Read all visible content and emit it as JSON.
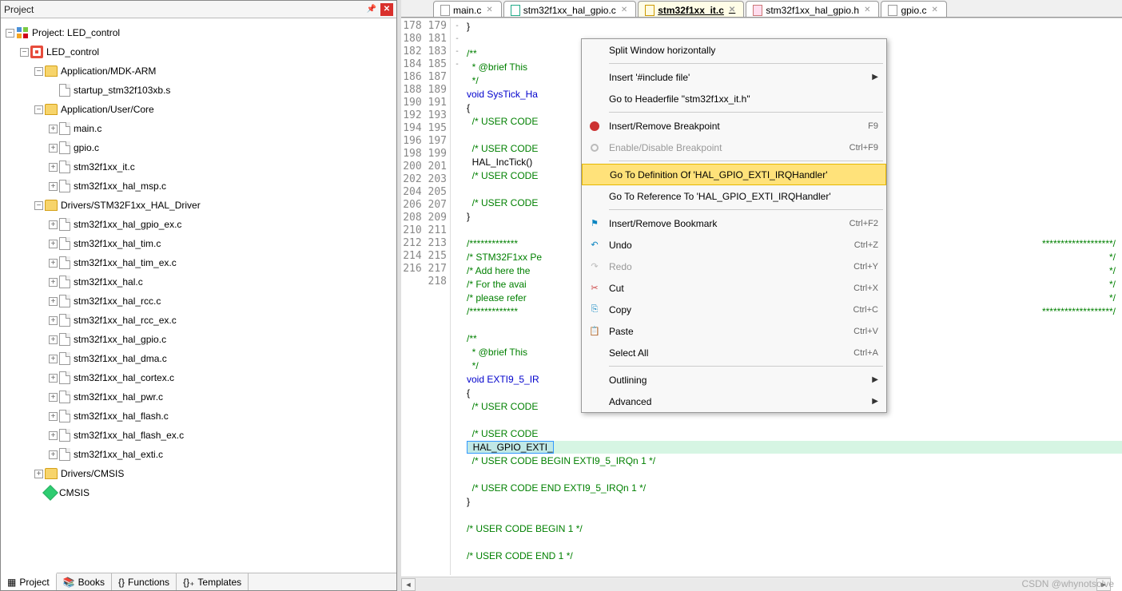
{
  "project_panel": {
    "title": "Project",
    "tree": {
      "root": "Project: LED_control",
      "target": "LED_control",
      "folders": [
        {
          "name": "Application/MDK-ARM",
          "files": [
            "startup_stm32f103xb.s"
          ]
        },
        {
          "name": "Application/User/Core",
          "files": [
            "main.c",
            "gpio.c",
            "stm32f1xx_it.c",
            "stm32f1xx_hal_msp.c"
          ]
        },
        {
          "name": "Drivers/STM32F1xx_HAL_Driver",
          "files": [
            "stm32f1xx_hal_gpio_ex.c",
            "stm32f1xx_hal_tim.c",
            "stm32f1xx_hal_tim_ex.c",
            "stm32f1xx_hal.c",
            "stm32f1xx_hal_rcc.c",
            "stm32f1xx_hal_rcc_ex.c",
            "stm32f1xx_hal_gpio.c",
            "stm32f1xx_hal_dma.c",
            "stm32f1xx_hal_cortex.c",
            "stm32f1xx_hal_pwr.c",
            "stm32f1xx_hal_flash.c",
            "stm32f1xx_hal_flash_ex.c",
            "stm32f1xx_hal_exti.c"
          ]
        },
        {
          "name": "Drivers/CMSIS",
          "files": []
        }
      ],
      "cmsis": "CMSIS"
    },
    "bottom_tabs": [
      "Project",
      "Books",
      "Functions",
      "Templates"
    ]
  },
  "editor": {
    "tabs": [
      {
        "label": "main.c",
        "kind": "c"
      },
      {
        "label": "stm32f1xx_hal_gpio.c",
        "kind": "green"
      },
      {
        "label": "stm32f1xx_it.c",
        "kind": "yellow",
        "active": true
      },
      {
        "label": "stm32f1xx_hal_gpio.h",
        "kind": "pink"
      },
      {
        "label": "gpio.c",
        "kind": "c"
      }
    ],
    "first_line": 178,
    "code_lines": [
      {
        "t": "}",
        "cls": ""
      },
      {
        "t": "",
        "cls": ""
      },
      {
        "t": "/**",
        "cls": "c-c",
        "fold": "-"
      },
      {
        "t": "  * @brief This",
        "cls": "c-c"
      },
      {
        "t": "  */",
        "cls": "c-c"
      },
      {
        "t": "void SysTick_Ha",
        "cls": "c-k"
      },
      {
        "t": "{",
        "cls": "",
        "fold": "-"
      },
      {
        "t": "  /* USER CODE ",
        "cls": "c-c"
      },
      {
        "t": "",
        "cls": ""
      },
      {
        "t": "  /* USER CODE ",
        "cls": "c-c"
      },
      {
        "t": "  HAL_IncTick()",
        "cls": ""
      },
      {
        "t": "  /* USER CODE ",
        "cls": "c-c"
      },
      {
        "t": "",
        "cls": ""
      },
      {
        "t": "  /* USER CODE ",
        "cls": "c-c"
      },
      {
        "t": "}",
        "cls": ""
      },
      {
        "t": "",
        "cls": ""
      },
      {
        "t": "/*************",
        "cls": "c-c"
      },
      {
        "t": "/* STM32F1xx Pe",
        "cls": "c-c"
      },
      {
        "t": "/* Add here the",
        "cls": "c-c"
      },
      {
        "t": "/* For the avai",
        "cls": "c-c"
      },
      {
        "t": "/* please refer",
        "cls": "c-c"
      },
      {
        "t": "/*************",
        "cls": "c-c"
      },
      {
        "t": "",
        "cls": ""
      },
      {
        "t": "/**",
        "cls": "c-c",
        "fold": "-"
      },
      {
        "t": "  * @brief This",
        "cls": "c-c"
      },
      {
        "t": "  */",
        "cls": "c-c"
      },
      {
        "t": "void EXTI9_5_IR",
        "cls": "c-k"
      },
      {
        "t": "{",
        "cls": "",
        "fold": "-"
      },
      {
        "t": "  /* USER CODE ",
        "cls": "c-c"
      },
      {
        "t": "",
        "cls": ""
      },
      {
        "t": "  /* USER CODE ",
        "cls": "c-c"
      },
      {
        "t": "  HAL_GPIO_EXTI_",
        "cls": "",
        "hl": true,
        "sel": true
      },
      {
        "t": "  /* USER CODE BEGIN EXTI9_5_IRQn 1 */",
        "cls": "c-c"
      },
      {
        "t": "",
        "cls": ""
      },
      {
        "t": "  /* USER CODE END EXTI9_5_IRQn 1 */",
        "cls": "c-c"
      },
      {
        "t": "}",
        "cls": ""
      },
      {
        "t": "",
        "cls": ""
      },
      {
        "t": "/* USER CODE BEGIN 1 */",
        "cls": "c-c"
      },
      {
        "t": "",
        "cls": ""
      },
      {
        "t": "/* USER CODE END 1 */",
        "cls": "c-c"
      },
      {
        "t": "",
        "cls": ""
      }
    ],
    "right_fragments": {
      "194": "*******************/",
      "195": "                  */",
      "196": "                  */",
      "197": "                  */",
      "198": "                  */",
      "199": "*******************/"
    }
  },
  "context_menu": [
    {
      "label": "Split Window horizontally"
    },
    {
      "sep": true
    },
    {
      "label": "Insert '#include file'",
      "arrow": true
    },
    {
      "label": "Go to Headerfile \"stm32f1xx_it.h\""
    },
    {
      "sep": true
    },
    {
      "label": "Insert/Remove Breakpoint",
      "shortcut": "F9",
      "icon": "red"
    },
    {
      "label": "Enable/Disable Breakpoint",
      "shortcut": "Ctrl+F9",
      "icon": "grey-o",
      "disabled": true
    },
    {
      "sep": true
    },
    {
      "label": "Go To Definition Of 'HAL_GPIO_EXTI_IRQHandler'",
      "selected": true
    },
    {
      "label": "Go To Reference To 'HAL_GPIO_EXTI_IRQHandler'"
    },
    {
      "sep": true
    },
    {
      "label": "Insert/Remove Bookmark",
      "shortcut": "Ctrl+F2",
      "icon": "flag"
    },
    {
      "label": "Undo",
      "shortcut": "Ctrl+Z",
      "icon": "undo"
    },
    {
      "label": "Redo",
      "shortcut": "Ctrl+Y",
      "icon": "redo",
      "disabled": true
    },
    {
      "label": "Cut",
      "shortcut": "Ctrl+X",
      "icon": "cut"
    },
    {
      "label": "Copy",
      "shortcut": "Ctrl+C",
      "icon": "copy"
    },
    {
      "label": "Paste",
      "shortcut": "Ctrl+V",
      "icon": "paste"
    },
    {
      "label": "Select All",
      "shortcut": "Ctrl+A"
    },
    {
      "sep": true
    },
    {
      "label": "Outlining",
      "arrow": true
    },
    {
      "label": "Advanced",
      "arrow": true
    }
  ],
  "watermark": "CSDN @whynotsolve"
}
